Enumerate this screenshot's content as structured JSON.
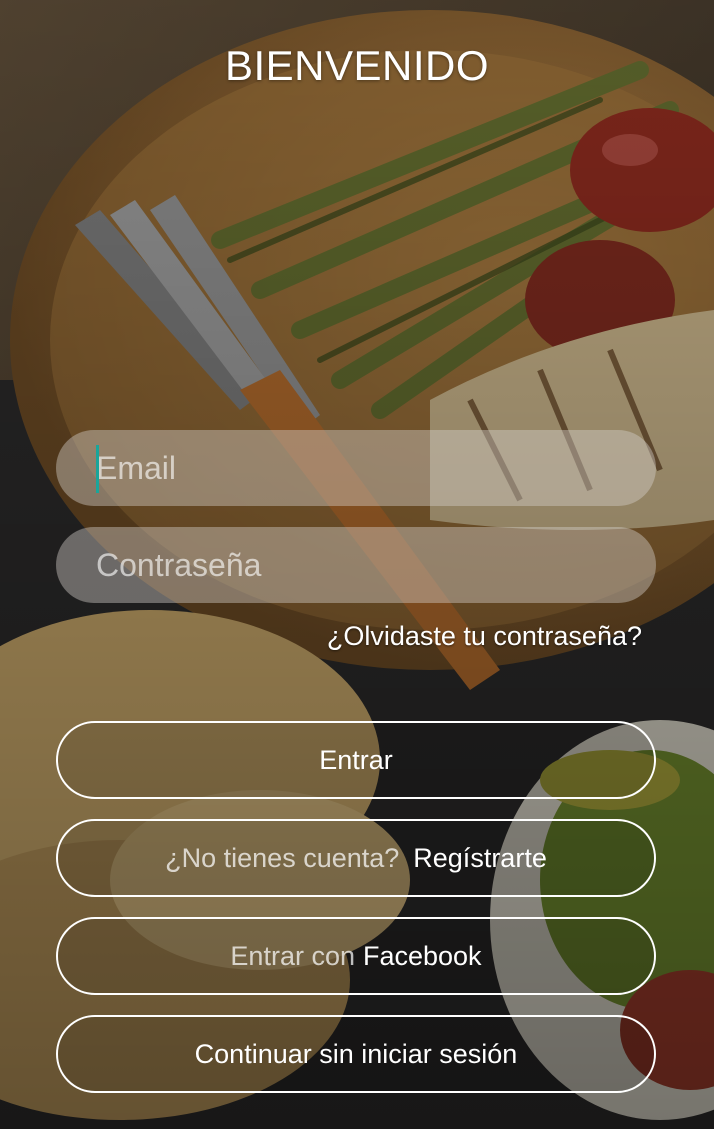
{
  "title": "BIENVENIDO",
  "email": {
    "placeholder": "Email"
  },
  "password": {
    "placeholder": "Contraseña"
  },
  "forgot_password": "¿Olvidaste tu contraseña?",
  "login_button": "Entrar",
  "register": {
    "prompt": "¿No tienes cuenta?",
    "action": "Regístrarte"
  },
  "facebook": {
    "prefix": "Entrar con",
    "brand": "Facebook"
  },
  "guest_button": "Continuar sin iniciar sesión",
  "colors": {
    "cursor": "#1aa59a",
    "text": "#ffffff"
  }
}
